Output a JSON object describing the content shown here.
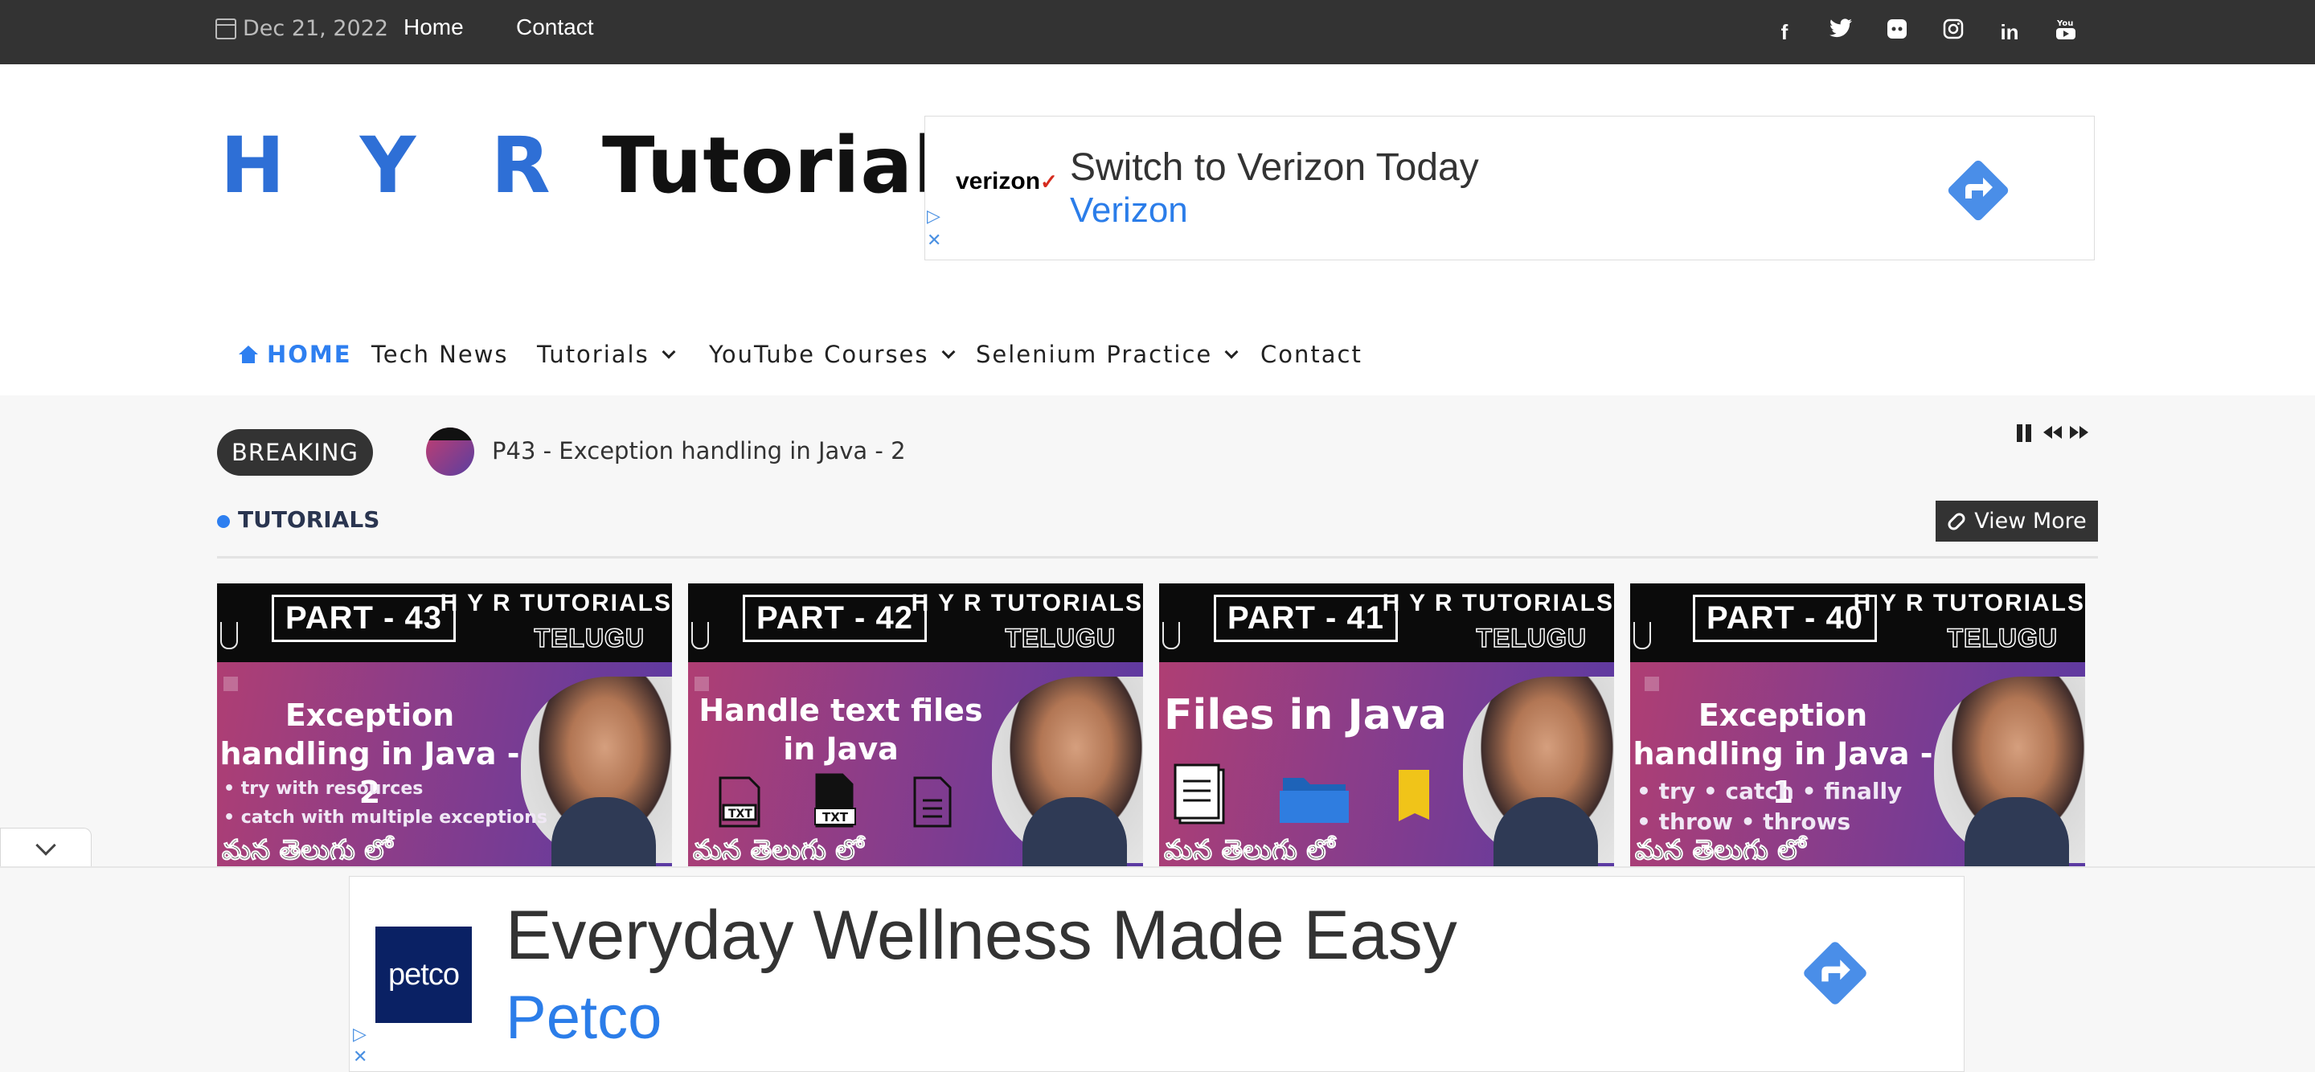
{
  "topbar": {
    "date": "Dec 21, 2022",
    "links": [
      "Home",
      "Contact"
    ],
    "social_icons": [
      "facebook-icon",
      "twitter-icon",
      "discord-icon",
      "instagram-icon",
      "linkedin-icon",
      "youtube-icon"
    ],
    "social_glyphs": [
      "f",
      "🐦",
      "◘",
      "◎",
      "in",
      "▶"
    ]
  },
  "logo": {
    "part1": "H Y R",
    "part2": " Tutorials"
  },
  "ad_top": {
    "advertiser_logo": "verizon",
    "headline": "Switch to Verizon Today",
    "brand": "Verizon"
  },
  "nav": {
    "items": [
      {
        "label": "HOME",
        "active": true,
        "icon": "home-icon"
      },
      {
        "label": "Tech News"
      },
      {
        "label": "Tutorials",
        "dropdown": true
      },
      {
        "label": "YouTube Courses",
        "dropdown": true
      },
      {
        "label": "Selenium Practice",
        "dropdown": true
      },
      {
        "label": "Contact"
      }
    ]
  },
  "breaking": {
    "badge": "BREAKING",
    "headline": "P43 - Exception handling in Java - 2",
    "controls": [
      "pause-icon",
      "previous-icon",
      "next-icon"
    ]
  },
  "section": {
    "title": "TUTORIALS",
    "view_more": "View More"
  },
  "cards": [
    {
      "part": "PART - 43",
      "channel": "H Y R TUTORIALS",
      "tag": "TELUGU",
      "title": "Exception handling in Java - 2",
      "bullets": [
        "• try with resources",
        "• catch with multiple exceptions"
      ],
      "script": "మన తెలుగు లో"
    },
    {
      "part": "PART - 42",
      "channel": "H Y R TUTORIALS",
      "tag": "TELUGU",
      "title": "Handle text files in Java",
      "bullets": [],
      "script": "మన తెలుగు లో"
    },
    {
      "part": "PART - 41",
      "channel": "H Y R TUTORIALS",
      "tag": "TELUGU",
      "title": "Files in Java",
      "bullets": [],
      "script": "మన తెలుగు లో"
    },
    {
      "part": "PART - 40",
      "channel": "H Y R TUTORIALS",
      "tag": "TELUGU",
      "title": "Exception handling in Java - 1",
      "bullets": [
        "• try   • catch  • finally",
        "• throw  • throws"
      ],
      "script": "మన తెలుగు లో"
    }
  ],
  "ad_bottom": {
    "advertiser_logo": "petco",
    "headline": "Everyday Wellness Made Easy",
    "brand": "Petco"
  },
  "colors": {
    "topbar_bg": "#333333",
    "accent_blue": "#2e7ff0",
    "ad_blue": "#2b7de9",
    "badge_bg": "#333333"
  }
}
